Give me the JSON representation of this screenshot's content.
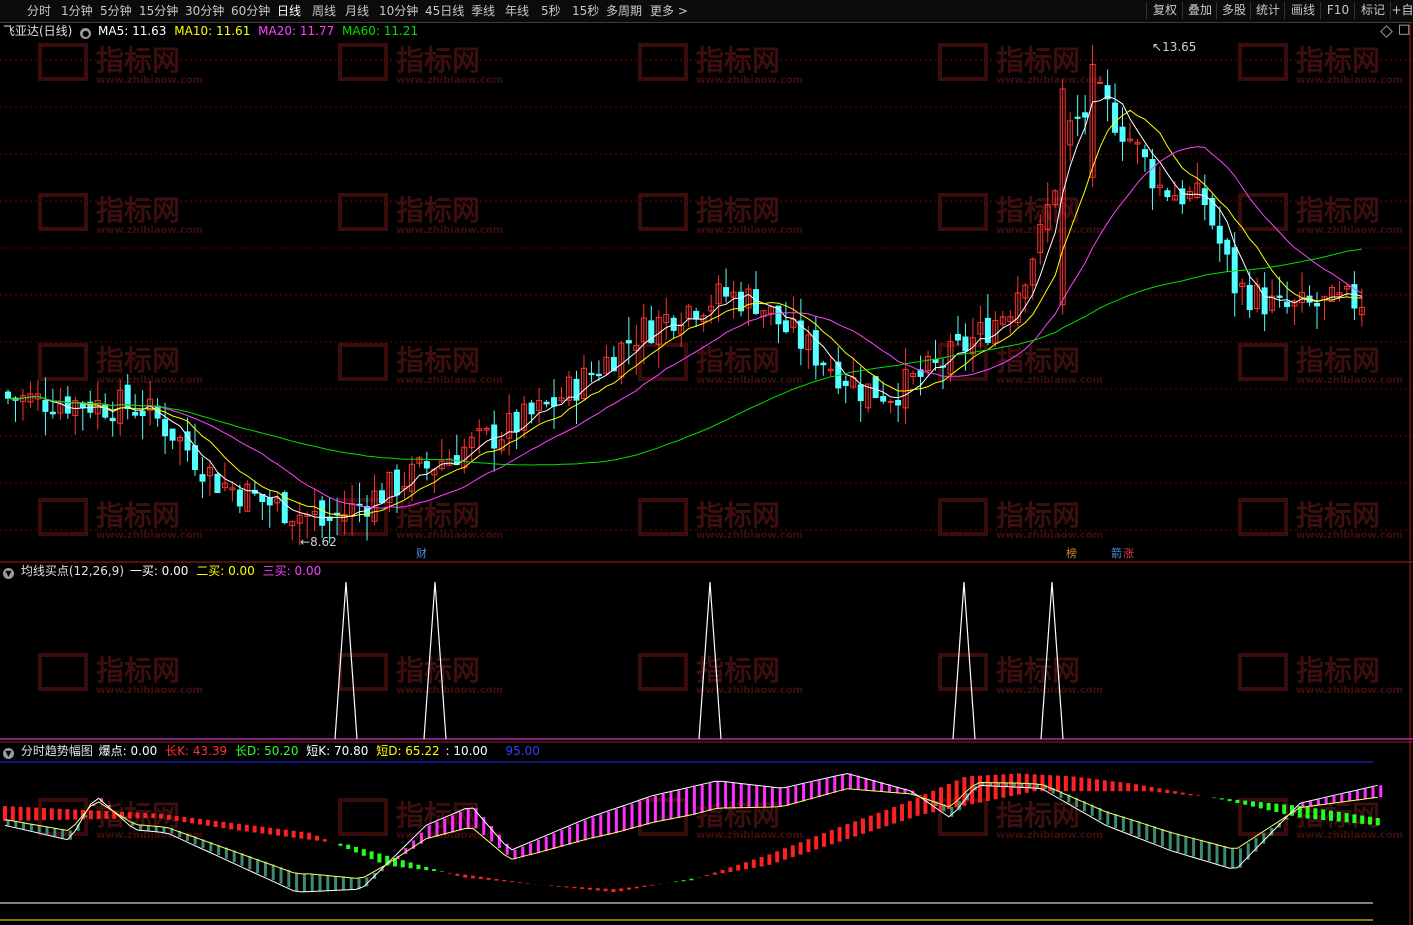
{
  "toolbar": {
    "periods": [
      "分时",
      "1分钟",
      "5分钟",
      "15分钟",
      "30分钟",
      "60分钟",
      "日线",
      "周线",
      "月线",
      "10分钟",
      "45日线",
      "季线",
      "年线",
      "5秒",
      "15秒",
      "多周期",
      "更多"
    ],
    "active": "日线",
    "right_buttons": [
      "复权",
      "叠加",
      "多股",
      "统计",
      "画线",
      "F10",
      "标记",
      "+自"
    ]
  },
  "main_panel": {
    "stock_name": "飞亚达(日线)",
    "ma": [
      {
        "label": "MA5: 11.63",
        "color": "#ffffff"
      },
      {
        "label": "MA10: 11.61",
        "color": "#ffff00"
      },
      {
        "label": "MA20: 11.77",
        "color": "#ff40ff"
      },
      {
        "label": "MA60: 11.21",
        "color": "#00e000"
      }
    ],
    "high_label": "13.65",
    "low_label": "8.62",
    "markers": [
      {
        "text": "财",
        "color": "#4a90e2"
      },
      {
        "text": "榜",
        "color": "#d08a30"
      },
      {
        "text": "箭",
        "color": "#4a90e2"
      },
      {
        "text": "涨",
        "color": "#e04040"
      }
    ]
  },
  "panel2": {
    "title": "均线买点(12,26,9)",
    "values": [
      {
        "label": "一买: 0.00",
        "color": "#ffffff"
      },
      {
        "label": "二买: 0.00",
        "color": "#ffff00"
      },
      {
        "label": "三买: 0.00",
        "color": "#ff40ff"
      }
    ]
  },
  "panel3": {
    "title": "分时趋势幅图",
    "values": [
      {
        "label": "爆点: 0.00",
        "color": "#ffffff"
      },
      {
        "label": "长K: 43.39",
        "color": "#ff3030"
      },
      {
        "label": "长D: 50.20",
        "color": "#30ff30"
      },
      {
        "label": "短K: 70.80",
        "color": "#ffffff"
      },
      {
        "label": "短D: 65.22",
        "color": "#ffff00"
      },
      {
        "label": ": 10.00",
        "color": "#ffffff"
      },
      {
        "label": "95.00",
        "color": "#3040ff"
      }
    ]
  },
  "watermark": {
    "brand": "指标网",
    "url": "www.zhibiaow.com"
  },
  "colors": {
    "up": "#ff3232",
    "down": "#54ffff",
    "ma5": "#ffffff",
    "ma10": "#ffff00",
    "ma20": "#ff40ff",
    "ma60": "#00e000",
    "grid": "#7a0000"
  }
}
